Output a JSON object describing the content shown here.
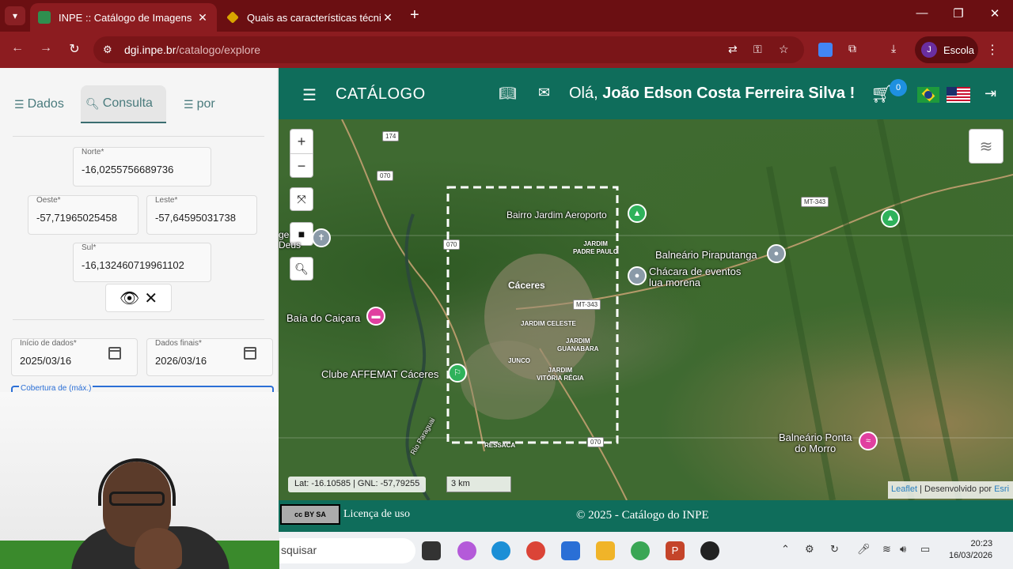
{
  "browser": {
    "tabs": [
      {
        "title": "INPE :: Catálogo de Imagens",
        "active": true
      },
      {
        "title": "Quais as características técnicas",
        "active": false
      }
    ],
    "url_host": "dgi.inpe.br",
    "url_path": "/catalogo/explore",
    "profile_initial": "J",
    "profile_name": "Escola"
  },
  "left_panel": {
    "tabs": [
      {
        "label": "Dados",
        "icon": "list-icon"
      },
      {
        "label": "Consulta",
        "icon": "search-icon"
      },
      {
        "label": "por",
        "icon": "list-icon"
      }
    ],
    "north": {
      "label": "Norte*",
      "value": "-16,0255756689736"
    },
    "west": {
      "label": "Oeste*",
      "value": "-57,71965025458"
    },
    "east": {
      "label": "Leste*",
      "value": "-57,64595031738"
    },
    "south": {
      "label": "Sul*",
      "value": "-16,132460719961102"
    },
    "start_date": {
      "label": "Início de dados*",
      "value": "2025/03/16"
    },
    "end_date": {
      "label": "Dados finais*",
      "value": "2026/03/16"
    },
    "coverage_label": "Cobertura de (máx.)"
  },
  "header": {
    "title": "CATÁLOGO",
    "greeting_prefix": "Olá,",
    "user_name": "João Edson Costa Ferreira Silva !",
    "cart_count": "0"
  },
  "map": {
    "labels": {
      "aeroporto": "Bairro Jardim Aeroporto",
      "piraputanga": "Balneário Piraputanga",
      "chacara": "Chácara de eventos\nlua morena",
      "caicara": "Baía do Caiçara",
      "affemat": "Clube AFFEMAT Cáceres",
      "ponta": "Balneário Ponta\ndo Morro",
      "caceres": "Cáceres",
      "padre_paulo": "JARDIM\nPADRE PAULO",
      "celeste": "JARDIM CELESTE",
      "guanabara": "JARDIM\nGUANABARA",
      "junco": "JUNCO",
      "vitoria": "JARDIM\nVITÓRIA RÉGIA",
      "ressaca": "RESSACA",
      "rio": "Rio Paraguai",
      "deus": "ge\nDeus"
    },
    "roads": {
      "r174": "174",
      "r070a": "070",
      "r070b": "070",
      "r070c": "070",
      "mt343a": "MT-343",
      "mt343b": "MT-343"
    },
    "coordinate_readout": "Lat: -16.10585 | GNL: -57,79255",
    "scale": "3 km",
    "attribution_leaflet": "Leaflet",
    "attribution_text": "| Desenvolvido por",
    "attribution_esri": "Esri"
  },
  "footer": {
    "cc_text": "cc BY SA",
    "license": "Licença de uso",
    "copyright": "© 2025 - Catálogo do INPE"
  },
  "taskbar": {
    "search_text": "squisar",
    "time": "20:23",
    "date": "16/03/2026"
  },
  "colors": {
    "brand_green": "#0f6d5b",
    "chrome_red": "#8c1c20",
    "accent_blue": "#1e90e0"
  }
}
